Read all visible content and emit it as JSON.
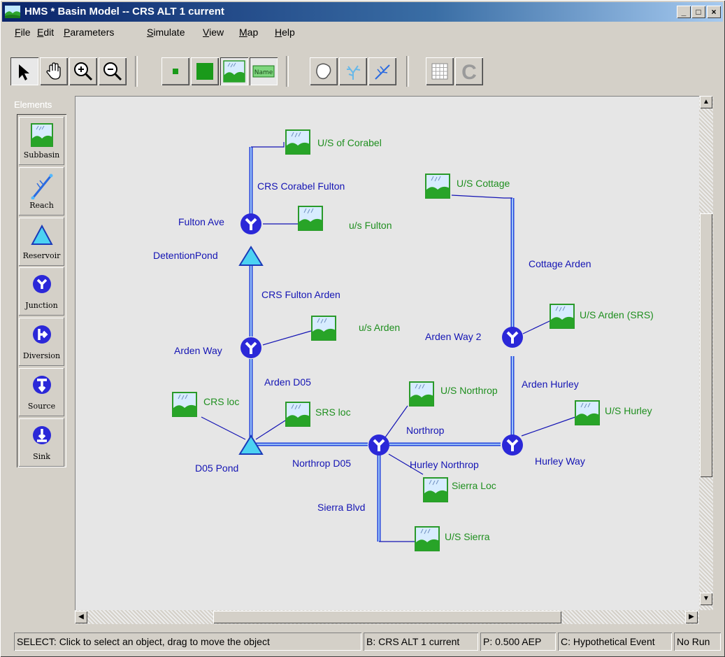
{
  "window": {
    "title": "HMS * Basin Model -- CRS ALT 1 current",
    "controls": {
      "minimize": "_",
      "maximize": "□",
      "close": "×"
    }
  },
  "menu": [
    {
      "label": "File",
      "key": "F",
      "rest": "ile"
    },
    {
      "label": "Edit",
      "key": "E",
      "rest": "dit"
    },
    {
      "label": "Parameters",
      "key": "P",
      "rest": "arameters"
    },
    {
      "label": "Simulate",
      "key": "S",
      "rest": "imulate"
    },
    {
      "label": "View",
      "key": "V",
      "rest": "iew"
    },
    {
      "label": "Map",
      "key": "M",
      "rest": "ap"
    },
    {
      "label": "Help",
      "key": "H",
      "rest": "elp"
    }
  ],
  "toolbar": {
    "tools": [
      "arrow-icon",
      "hand-icon",
      "zoom-in-icon",
      "zoom-out-icon",
      "small-square-icon",
      "large-square-icon",
      "subbasin-toggle-icon",
      "name-toggle-icon",
      "outline-icon",
      "stream-icon",
      "reach-icon",
      "grid-icon",
      "c-icon"
    ],
    "name_label": "Name",
    "c_label": "C"
  },
  "elements_palette": {
    "title": "Elements",
    "items": [
      {
        "label": "Subbasin",
        "icon": "subbasin-icon"
      },
      {
        "label": "Reach",
        "icon": "reach-icon"
      },
      {
        "label": "Reservoir",
        "icon": "reservoir-icon"
      },
      {
        "label": "Junction",
        "icon": "junction-icon"
      },
      {
        "label": "Diversion",
        "icon": "diversion-icon"
      },
      {
        "label": "Source",
        "icon": "source-icon"
      },
      {
        "label": "Sink",
        "icon": "sink-icon"
      }
    ]
  },
  "basin_map": {
    "subbasins": [
      "U/S of Corabel",
      "u/s Fulton",
      "u/s Arden",
      "CRS loc",
      "SRS loc",
      "U/S Cottage",
      "U/S Arden (SRS)",
      "U/S Northrop",
      "U/S Hurley",
      "Sierra Loc",
      "U/S Sierra"
    ],
    "junctions": [
      "Fulton Ave",
      "Arden Way",
      "Arden Way 2",
      "Hurley Way"
    ],
    "reservoirs": [
      "DetentionPond",
      "D05 Pond"
    ],
    "reaches": [
      "CRS Corabel Fulton",
      "CRS Fulton Arden",
      "Arden D05",
      "Northrop D05",
      "Northrop",
      "Hurley Northrop",
      "Sierra Blvd",
      "Cottage Arden",
      "Arden Hurley"
    ]
  },
  "status": {
    "message": "SELECT: Click to select an object, drag to move the object",
    "basin": "B: CRS ALT 1 current",
    "precip": "P: 0.500 AEP",
    "control": "C: Hypothetical Event",
    "run": "No Run"
  },
  "colors": {
    "label_blue": "#1414b4",
    "label_green": "#1f8f1f",
    "canvas": "#e6e6e6"
  }
}
